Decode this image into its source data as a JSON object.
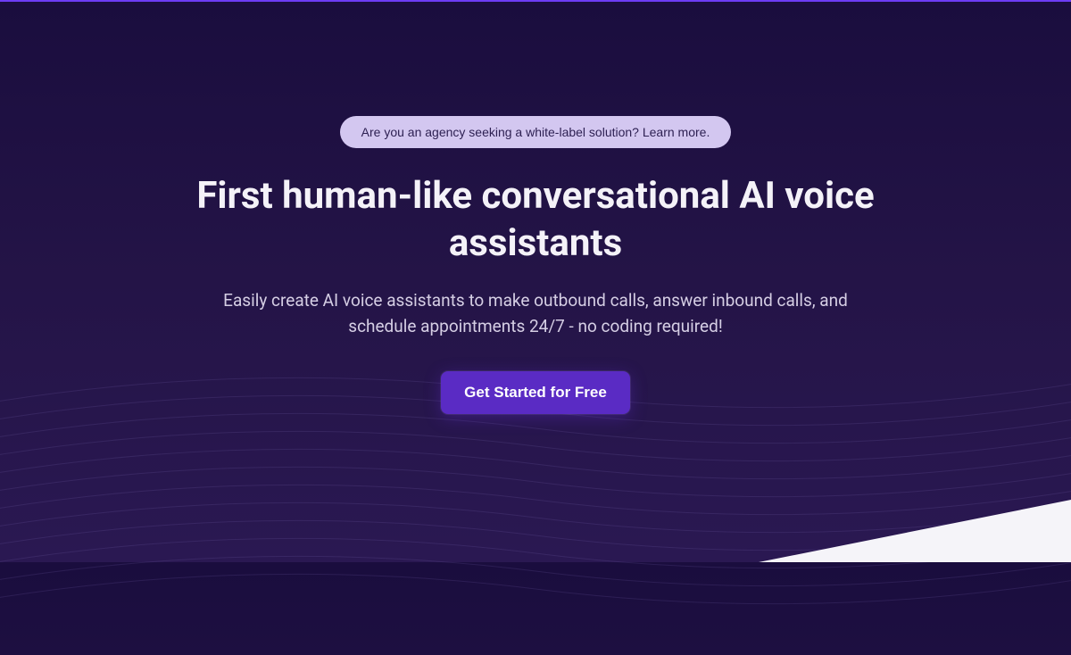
{
  "hero": {
    "pill_label": "Are you an agency seeking a white-label solution? Learn more.",
    "headline": "First human-like conversational AI voice assistants",
    "subhead": "Easily create AI voice assistants to make outbound calls, answer inbound calls, and schedule appointments 24/7 - no coding required!",
    "cta_label": "Get Started for Free"
  },
  "colors": {
    "accent": "#5a2bc4",
    "pill_bg": "#d3c7f0",
    "bg_start": "#1a0d3e",
    "bg_end": "#2a1852"
  }
}
